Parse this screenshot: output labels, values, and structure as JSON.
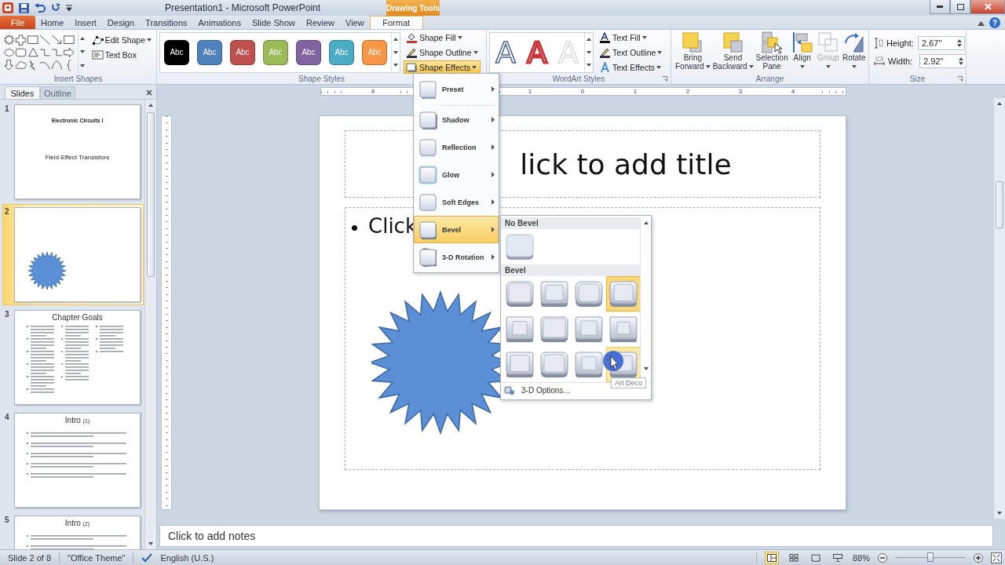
{
  "title_bar": {
    "title": "Presentation1  -  Microsoft PowerPoint",
    "context_label": "Drawing Tools"
  },
  "tabs": [
    {
      "label": "File",
      "kind": "file",
      "selected": false
    },
    {
      "label": "Home",
      "kind": "tab",
      "selected": false
    },
    {
      "label": "Insert",
      "kind": "tab",
      "selected": false
    },
    {
      "label": "Design",
      "kind": "tab",
      "selected": false
    },
    {
      "label": "Transitions",
      "kind": "tab",
      "selected": false
    },
    {
      "label": "Animations",
      "kind": "tab",
      "selected": false
    },
    {
      "label": "Slide Show",
      "kind": "tab",
      "selected": false
    },
    {
      "label": "Review",
      "kind": "tab",
      "selected": false
    },
    {
      "label": "View",
      "kind": "tab",
      "selected": false
    },
    {
      "label": "Format",
      "kind": "context",
      "selected": true
    }
  ],
  "help": "?",
  "ribbon": {
    "insert_shapes": {
      "label": "Insert Shapes",
      "commands": [
        {
          "label": "Edit Shape",
          "kind": "edit-shape",
          "dropdown": true
        },
        {
          "label": "Text Box",
          "kind": "text-box",
          "dropdown": false
        }
      ]
    },
    "shape_styles": {
      "label": "Shape Styles",
      "presets": [
        {
          "text": "Abc",
          "color": "#000000"
        },
        {
          "text": "Abc",
          "color": "#4f81bd"
        },
        {
          "text": "Abc",
          "color": "#c0504d"
        },
        {
          "text": "Abc",
          "color": "#9bbb59"
        },
        {
          "text": "Abc",
          "color": "#8064a2"
        },
        {
          "text": "Abc",
          "color": "#4bacc6"
        },
        {
          "text": "Abc",
          "color": "#f79646"
        }
      ],
      "commands": [
        {
          "label": "Shape Fill",
          "kind": "fill",
          "dropdown": true,
          "selected": false
        },
        {
          "label": "Shape Outline",
          "kind": "outline",
          "dropdown": true,
          "selected": false
        },
        {
          "label": "Shape Effects",
          "kind": "effects",
          "dropdown": true,
          "selected": true
        }
      ]
    },
    "wordart_styles": {
      "label": "WordArt Styles",
      "presets": [
        {
          "text": "A",
          "kind": "blue-outline"
        },
        {
          "text": "A",
          "kind": "red"
        },
        {
          "text": "A",
          "kind": "faint"
        }
      ],
      "commands": [
        {
          "label": "Text Fill",
          "kind": "fill",
          "dropdown": true
        },
        {
          "label": "Text Outline",
          "kind": "outline",
          "dropdown": true
        },
        {
          "label": "Text Effects",
          "kind": "effects",
          "dropdown": true
        }
      ]
    },
    "arrange": {
      "label": "Arrange",
      "buttons": [
        {
          "lines": [
            "Bring",
            "Forward"
          ],
          "kind": "bring-forward",
          "dropdown": true,
          "disabled": false
        },
        {
          "lines": [
            "Send",
            "Backward"
          ],
          "kind": "send-backward",
          "dropdown": true,
          "disabled": false
        },
        {
          "lines": [
            "Selection",
            "Pane"
          ],
          "kind": "selection-pane",
          "dropdown": false,
          "disabled": false
        },
        {
          "lines": [
            "Align"
          ],
          "kind": "align",
          "dropdown": true,
          "disabled": false
        },
        {
          "lines": [
            "Group"
          ],
          "kind": "group",
          "dropdown": true,
          "disabled": true
        },
        {
          "lines": [
            "Rotate"
          ],
          "kind": "rotate",
          "dropdown": true,
          "disabled": false
        }
      ]
    },
    "size": {
      "label": "Size",
      "fields": [
        {
          "label": "Height:",
          "value": "2.67\"",
          "kind": "height"
        },
        {
          "label": "Width:",
          "value": "2.92\"",
          "kind": "width"
        }
      ]
    }
  },
  "slides_panel": {
    "tabs": [
      {
        "label": "Slides",
        "selected": true
      },
      {
        "label": "Outline",
        "selected": false
      }
    ],
    "slides": [
      {
        "number": "1",
        "kind": "title",
        "lines": [
          "Electronic Circuits I",
          "Field-Effect Transistors"
        ],
        "selected": false
      },
      {
        "number": "2",
        "kind": "shape",
        "selected": true
      },
      {
        "number": "3",
        "kind": "columns",
        "title": "Chapter Goals",
        "selected": false
      },
      {
        "number": "4",
        "kind": "bullets",
        "title": "Intro",
        "sub": "(1)",
        "selected": false
      },
      {
        "number": "5",
        "kind": "bullets",
        "title": "Intro",
        "sub": "(2)",
        "selected": false
      }
    ]
  },
  "ruler": {
    "left_numbers": [
      "4"
    ],
    "right_numbers": [
      "1",
      "0",
      "1",
      "2",
      "3",
      "4"
    ]
  },
  "slide": {
    "title_placeholder": "lick to add title",
    "body_placeholder": "Click"
  },
  "notes": {
    "placeholder": "Click to add notes"
  },
  "status_bar": {
    "texts": [
      "Slide 2 of 8",
      "\"Office Theme\"",
      "English (U.S.)"
    ],
    "views": [
      {
        "kind": "normal",
        "selected": true
      },
      {
        "kind": "sorter",
        "selected": false
      },
      {
        "kind": "reading",
        "selected": false
      },
      {
        "kind": "slideshow",
        "selected": false
      }
    ],
    "zoom": {
      "label": "88%",
      "level": 0.5
    }
  },
  "effects_menu": {
    "items": [
      {
        "label": "Preset",
        "kind": "preset",
        "selected": false
      },
      {
        "label": "Shadow",
        "kind": "shadow",
        "selected": false
      },
      {
        "label": "Reflection",
        "kind": "reflection",
        "selected": false
      },
      {
        "label": "Glow",
        "kind": "glow",
        "selected": false
      },
      {
        "label": "Soft Edges",
        "kind": "soft-edges",
        "selected": false
      },
      {
        "label": "Bevel",
        "kind": "bevel",
        "selected": true
      },
      {
        "label": "3-D Rotation",
        "kind": "rotation",
        "selected": false
      }
    ]
  },
  "bevel_gallery": {
    "no_bevel_title": "No Bevel",
    "bevel_title": "Bevel",
    "options": [
      {
        "selected": false,
        "hovered": false
      },
      {
        "selected": false,
        "hovered": false
      },
      {
        "selected": false,
        "hovered": false
      },
      {
        "selected": true,
        "hovered": false
      },
      {
        "selected": false,
        "hovered": false
      },
      {
        "selected": false,
        "hovered": false
      },
      {
        "selected": false,
        "hovered": false
      },
      {
        "selected": false,
        "hovered": false
      },
      {
        "selected": false,
        "hovered": false
      },
      {
        "selected": false,
        "hovered": false
      },
      {
        "selected": false,
        "hovered": false
      },
      {
        "selected": false,
        "hovered": true
      }
    ],
    "footer": "3-D Options...",
    "tooltip": "Art Deco"
  }
}
